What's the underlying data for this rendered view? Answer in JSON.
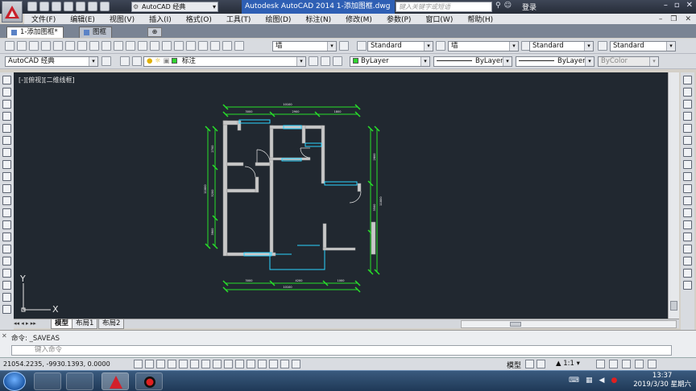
{
  "title_bar": {
    "workspace": "AutoCAD 经典",
    "doc_title": "Autodesk AutoCAD 2014   1-添加图框.dwg",
    "search_placeholder": "键入关键字或短语",
    "login": "登录"
  },
  "menu": [
    "文件(F)",
    "编辑(E)",
    "视图(V)",
    "插入(I)",
    "格式(O)",
    "工具(T)",
    "绘图(D)",
    "标注(N)",
    "修改(M)",
    "参数(P)",
    "窗口(W)",
    "帮助(H)"
  ],
  "file_tabs": [
    {
      "label": "1-添加图框*",
      "active": true
    },
    {
      "label": "图框",
      "active": false
    }
  ],
  "toolbar1": {
    "layer_combo": "墙",
    "text_style": "Standard",
    "dim_layer": "墙",
    "dim_style": "Standard",
    "table_style": "Standard"
  },
  "toolbar2": {
    "workspace_combo": "AutoCAD 经典",
    "layer_state": "标注",
    "color": "ByLayer",
    "linetype": "ByLayer",
    "lineweight": "ByLayer",
    "plotstyle": "ByColor",
    "accent_green": "#2fd52f"
  },
  "viewport": {
    "label": "[-][俯视][二维线框]",
    "background": "#212830",
    "ucs_x": "X",
    "ucs_y": "Y"
  },
  "drawing_dims": {
    "top_total": "10100",
    "top_parts": [
      "3000",
      "2900",
      "1800"
    ],
    "bottom_total": "10100",
    "bottom_parts": [
      "3000",
      "4200",
      "1000"
    ],
    "left_total": "11800",
    "left_parts": [
      "2700",
      "5200",
      "3900"
    ],
    "right_total": "11800",
    "right_parts": [
      "2800",
      "3500",
      "2100"
    ]
  },
  "layout_tabs": [
    {
      "label": "模型",
      "active": true
    },
    {
      "label": "布局1",
      "active": false
    },
    {
      "label": "布局2",
      "active": false
    }
  ],
  "command": {
    "history": "命令:  _SAVEAS",
    "placeholder": "键入命令"
  },
  "status": {
    "coords": "21054.2235, -9930.1393, 0.0000",
    "model": "模型",
    "anno_scale": "1:1"
  },
  "taskbar": {
    "time": "13:37",
    "date": "2019/3/30 星期六"
  }
}
